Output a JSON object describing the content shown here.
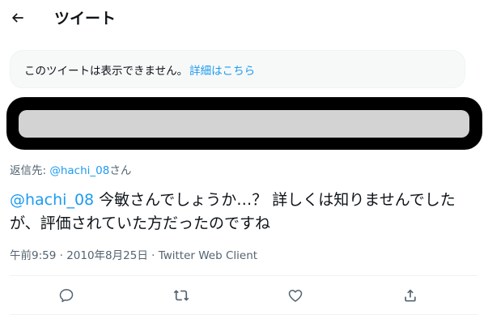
{
  "header": {
    "title": "ツイート"
  },
  "notice": {
    "text": "このツイートは表示できません。",
    "link": "詳細はこちら"
  },
  "reply": {
    "prefix": "返信先: ",
    "handle": "@hachi_08",
    "suffix": "さん"
  },
  "tweet": {
    "mention": "@hachi_08",
    "body": " 今敏さんでしょうか…？ 詳しくは知りませんでしたが、評価されていた方だったのですね"
  },
  "meta": {
    "time": "午前9:59",
    "sep1": " · ",
    "date": "2010年8月25日",
    "sep2": " · ",
    "client": "Twitter Web Client"
  },
  "icons": [
    "back-arrow-icon",
    "reply-icon",
    "retweet-icon",
    "like-icon",
    "share-icon"
  ],
  "colors": {
    "link": "#1d9bf0",
    "secondary_text": "#536471",
    "redaction_fill": "#d3d3d3",
    "redaction_border": "#000000"
  }
}
